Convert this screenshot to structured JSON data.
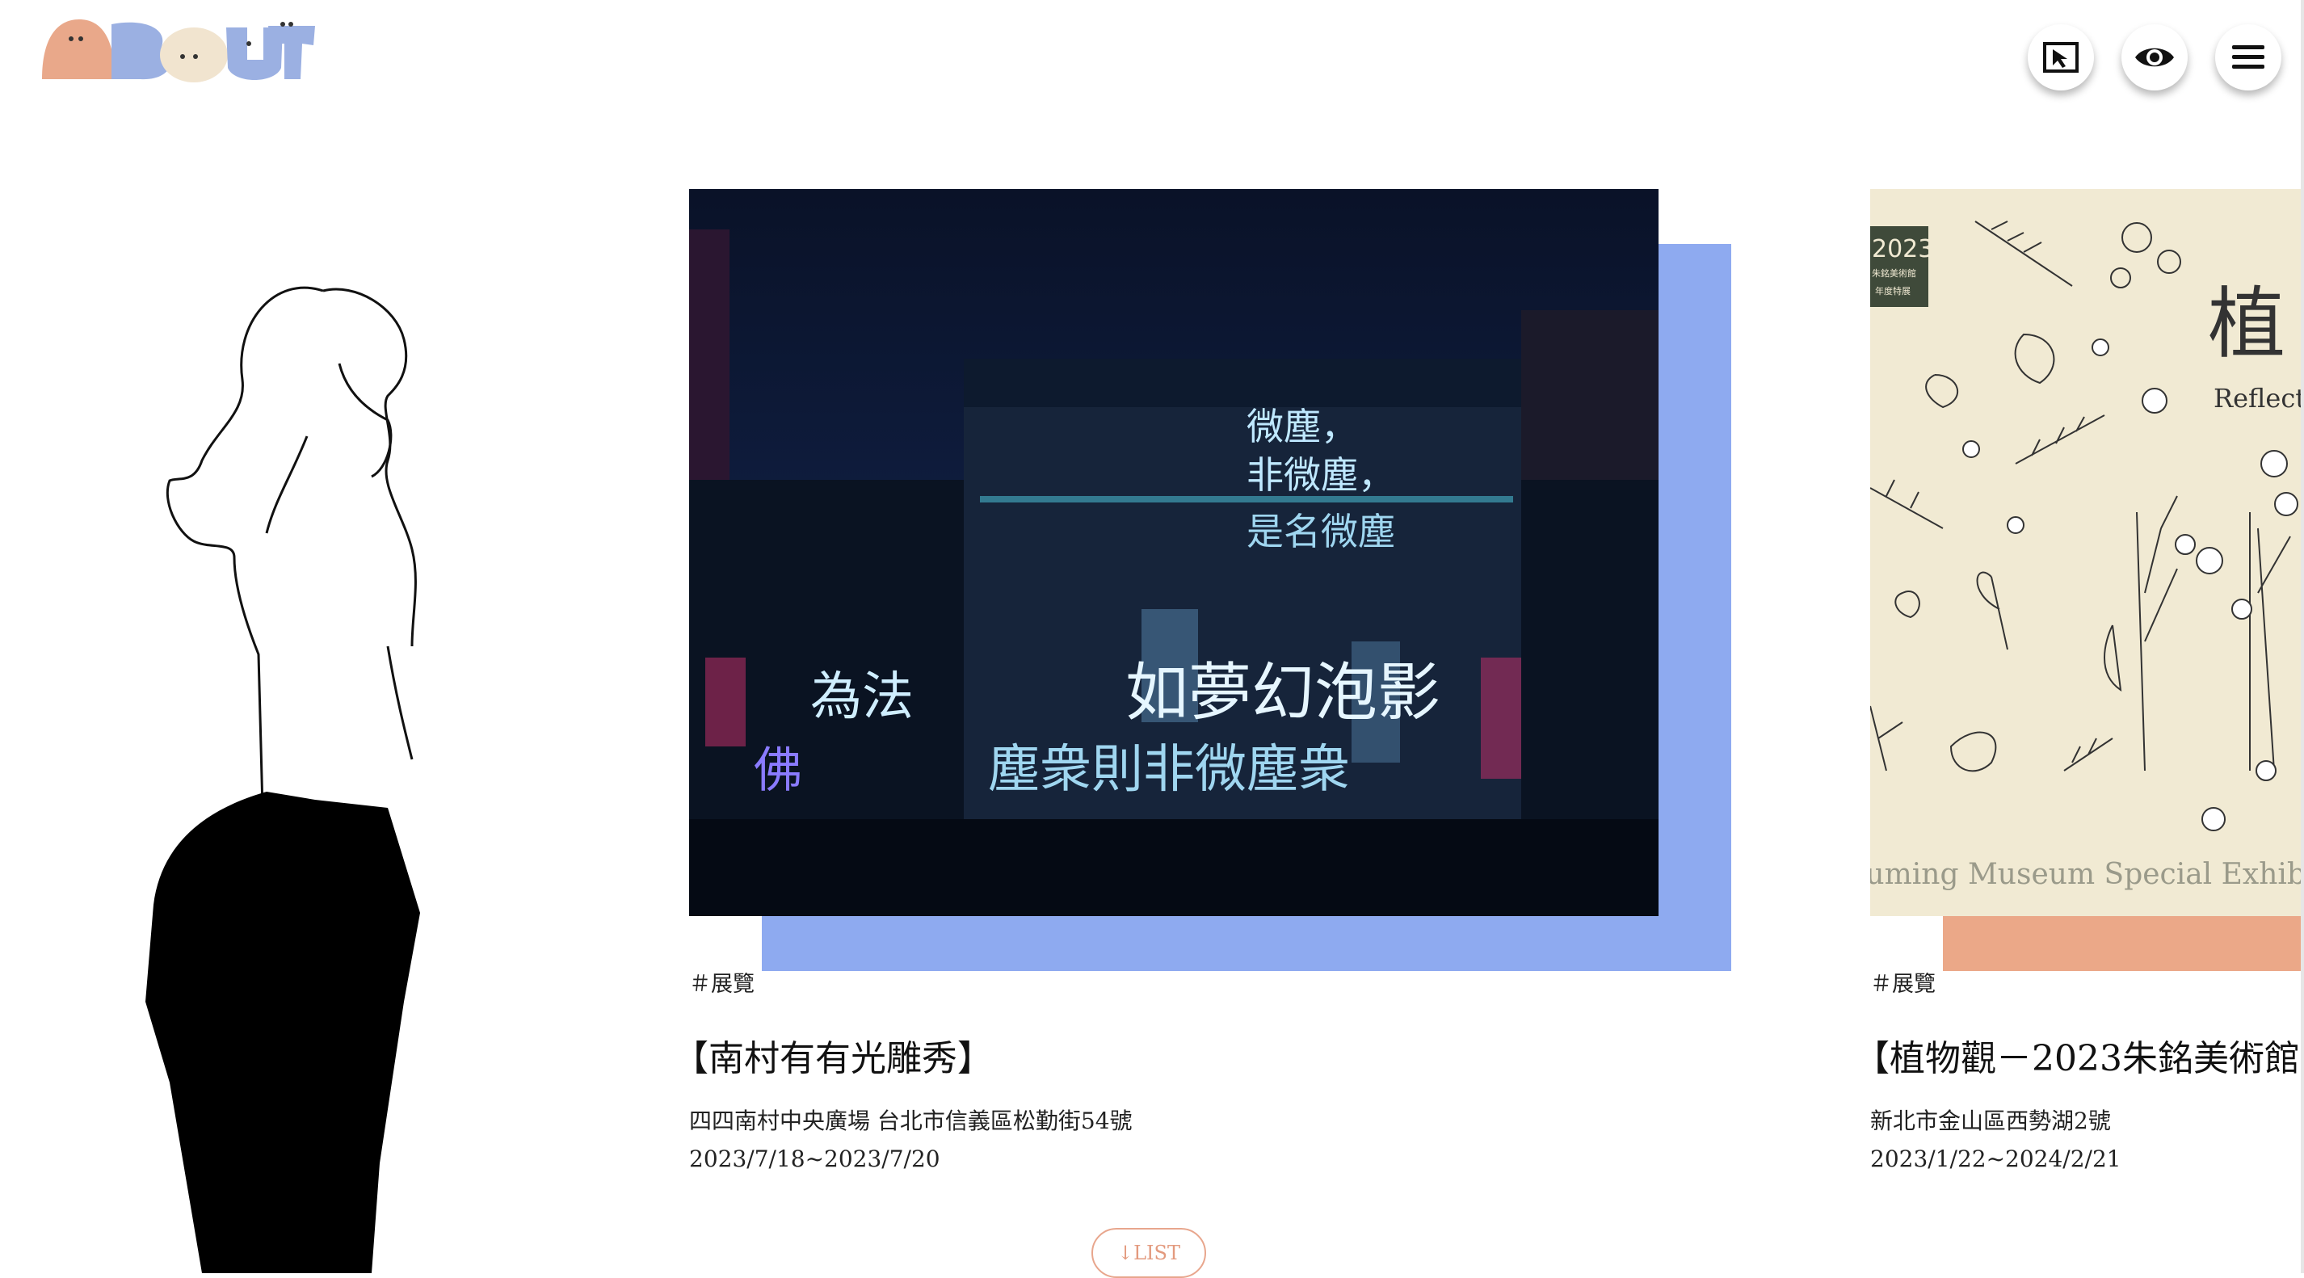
{
  "brand": {
    "logo_text": "ABOUT"
  },
  "header": {
    "icons": [
      "return-cursor-icon",
      "eye-icon",
      "hamburger-menu-icon"
    ]
  },
  "colors": {
    "accent_blue": "#8eaaf0",
    "accent_salmon": "#eba888",
    "logo_salmon": "#e9a88a",
    "logo_blue": "#9bb0e2",
    "logo_cream": "#f1e4cf"
  },
  "cards": [
    {
      "tag": "＃展覽",
      "title": "【南村有有光雕秀】",
      "address": "四四南村中央廣場 台北市信義區松勤街54號",
      "date": "2023/7/18~2023/7/20",
      "image_texts": [
        "微塵，",
        "非微塵，",
        "是名微塵",
        "為法",
        "如夢幻泡影",
        "佛",
        "塵衆則非微塵衆"
      ]
    },
    {
      "tag": "＃展覽",
      "title": "【植物觀－2023朱銘美術館",
      "address": "新北市金山區西勢湖2號",
      "date": "2023/1/22~2024/2/21",
      "image_texts": [
        "2023",
        "朱銘美術館",
        "年度特展",
        "植",
        "Reflect",
        "Juming Museum Special Exhibit"
      ]
    }
  ],
  "list_button": {
    "arrow": "↓",
    "label": "LIST"
  }
}
